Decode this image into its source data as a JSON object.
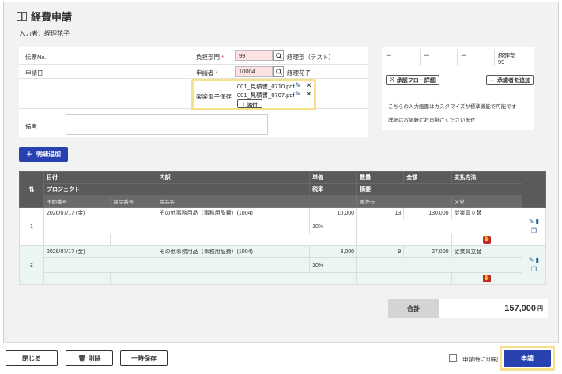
{
  "header": {
    "title": "経費申請",
    "inputter": "入力者：経理花子"
  },
  "form": {
    "slip_no_label": "伝票No.",
    "apply_date_label": "申請日",
    "dept_label": "負担部門",
    "dept_value": "99",
    "dept_name": "経理部（テスト）",
    "applicant_label": "申請者",
    "applicant_value": "10004",
    "applicant_name": "経理花子",
    "ebook_label": "楽楽電子保存",
    "files": [
      "001_見積書_0710.pdf",
      "001_見積書_0707.pdf"
    ],
    "attach_label": "添付",
    "remarks_label": "備考",
    "required_mark": "*"
  },
  "approval": {
    "cells": [
      "ー",
      "ー",
      "ー"
    ],
    "dept": "経理部",
    "dept_code": "99",
    "flow_button": "承認フロー詳細",
    "add_button": "承認者を追加",
    "note1": "こちらの入力画面はカスタマイズが標準機能で可能です",
    "note2": "詳細はお気軽にお声掛けくださいませ"
  },
  "add_detail_button": "明細追加",
  "table": {
    "h1": [
      "日付",
      "内訳",
      "単価",
      "数量",
      "金額",
      "支払方法"
    ],
    "h2": [
      "プロジェクト",
      "税率",
      "摘要"
    ],
    "h3": [
      "予約番号",
      "商品番号",
      "商品名",
      "販売元",
      "区分"
    ],
    "rows": [
      {
        "no": "1",
        "date": "2026/07/17 (金)",
        "item": "その他事務用品（事務用品費）(1004)",
        "price": "10,000",
        "qty": "13",
        "amount": "130,000",
        "pay": "従業員立替",
        "tax": "10%"
      },
      {
        "no": "2",
        "date": "2026/07/17 (金)",
        "item": "その他事務用品（事務用品費）(1004)",
        "price": "3,000",
        "qty": "9",
        "amount": "27,000",
        "pay": "従業員立替",
        "tax": "10%"
      }
    ]
  },
  "total": {
    "label": "合計",
    "value": "157,000",
    "unit": "円"
  },
  "footer": {
    "close": "閉じる",
    "delete": "削除",
    "temp_save": "一時保存",
    "print_label": "申請時に印刷",
    "submit": "申請"
  },
  "colors": {
    "accent": "#2741b0",
    "highlight": "#f6e08a",
    "required_bg": "#fde2e2",
    "row_alt": "#eaf6ef"
  }
}
